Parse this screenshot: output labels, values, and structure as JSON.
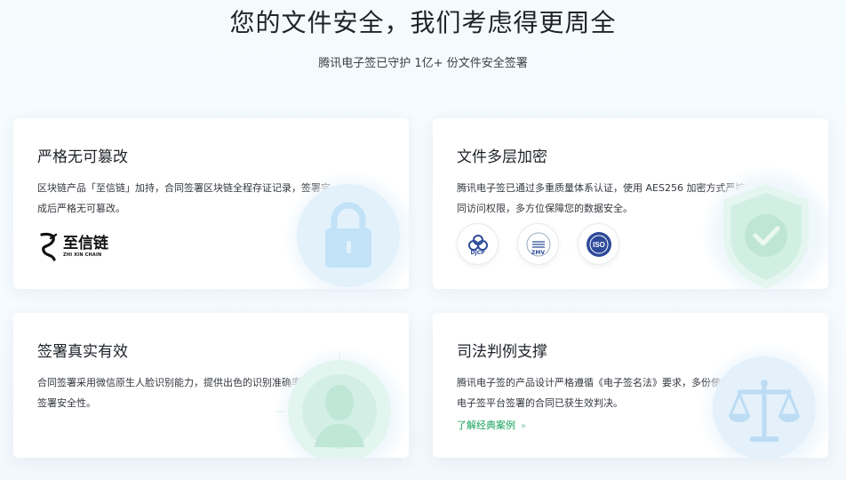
{
  "hero": {
    "title": "您的文件安全，我们考虑得更周全",
    "subtitle": "腾讯电子签已守护 1亿+ 份文件安全签署"
  },
  "cards": [
    {
      "title": "严格无可篡改",
      "desc": "区块链产品「至信链」加持，合同签署区块链全程存证记录，签署完成后严格无可篡改。",
      "brand": {
        "cn": "至信链",
        "en": "ZHI XIN CHAIN"
      },
      "icon": "lock-icon"
    },
    {
      "title": "文件多层加密",
      "desc": "腾讯电子签已通过多重质量体系认证，使用 AES256 加密方式严控合同访问权限，多方位保障您的数据安全。",
      "certs": [
        "DJCP",
        "ZMV",
        "ISO"
      ],
      "icon": "shield-check-icon"
    },
    {
      "title": "签署真实有效",
      "desc": "合同签署采用微信原生人脸识别能力，提供出色的识别准确率，保障签署安全性。",
      "icon": "face-id-icon"
    },
    {
      "title": "司法判例支撑",
      "desc": "腾讯电子签的产品设计严格遵循《电子签名法》要求，多份使用腾讯电子签平台签署的合同已获生效判决。",
      "link": "了解经典案例",
      "icon": "scale-icon"
    }
  ],
  "colors": {
    "accent_green": "#16a35a",
    "cert_blue": "#2d4b9a"
  }
}
